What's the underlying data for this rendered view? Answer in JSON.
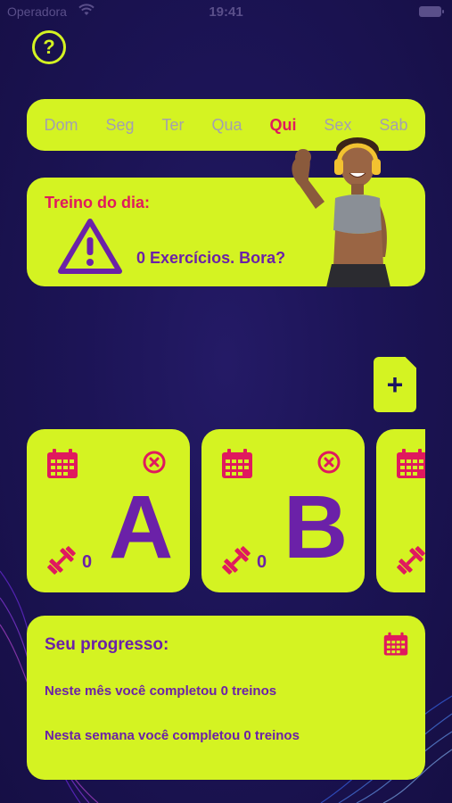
{
  "status_bar": {
    "carrier": "Operadora",
    "time": "19:41"
  },
  "days": [
    {
      "label": "Dom",
      "active": false
    },
    {
      "label": "Seg",
      "active": false
    },
    {
      "label": "Ter",
      "active": false
    },
    {
      "label": "Qua",
      "active": false
    },
    {
      "label": "Qui",
      "active": true
    },
    {
      "label": "Sex",
      "active": false
    },
    {
      "label": "Sab",
      "active": false
    }
  ],
  "today": {
    "title": "Treino do dia:",
    "exercise_count": "0 Exercícios. Bora?"
  },
  "workouts": [
    {
      "letter": "A",
      "count": "0"
    },
    {
      "letter": "B",
      "count": "0"
    },
    {
      "letter": "",
      "count": ""
    }
  ],
  "progress": {
    "title": "Seu progresso:",
    "month_text": "Neste mês você completou 0 treinos",
    "week_text": "Nesta semana você completou 0 treinos"
  },
  "icons": {
    "help": "question-circle-icon",
    "warning": "warning-triangle-icon",
    "add": "add-document-icon",
    "calendar": "calendar-icon",
    "close": "close-circle-icon",
    "dumbbell": "dumbbell-icon"
  },
  "colors": {
    "background": "#1c1456",
    "accent": "#d4f322",
    "active_day": "#e0195e",
    "primary_text": "#6b21a8"
  }
}
